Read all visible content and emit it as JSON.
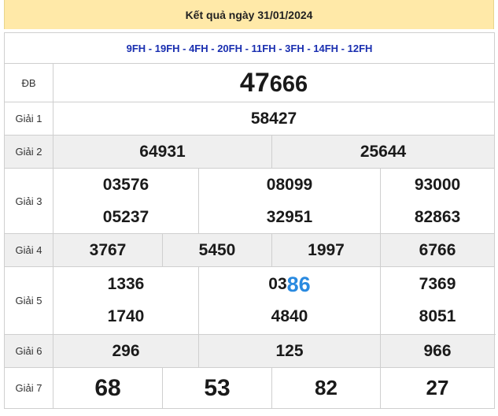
{
  "header": {
    "title": "Kết quả ngày 31/01/2024"
  },
  "codes": "9FH - 19FH - 4FH - 20FH - 11FH - 3FH - 14FH - 12FH",
  "labels": {
    "db": "ĐB",
    "g1": "Giải 1",
    "g2": "Giải 2",
    "g3": "Giải 3",
    "g4": "Giải 4",
    "g5": "Giải 5",
    "g6": "Giải 6",
    "g7": "Giải 7"
  },
  "db": {
    "prefix": "47",
    "suffix": "666"
  },
  "g1": [
    "58427"
  ],
  "g2": [
    "64931",
    "25644"
  ],
  "g3": [
    "03576",
    "08099",
    "93000",
    "05237",
    "32951",
    "82863"
  ],
  "g4": [
    "3767",
    "5450",
    "1997",
    "6766"
  ],
  "g5": {
    "r1c1": "1336",
    "r1c2_prefix": "03",
    "r1c2_suffix": "86",
    "r1c3": "7369",
    "r2c1": "1740",
    "r2c2": "4840",
    "r2c3": "8051"
  },
  "g6": [
    "296",
    "125",
    "966"
  ],
  "g7": [
    "68",
    "53",
    "82",
    "27"
  ],
  "colors": {
    "header_bg": "#ffe9a8",
    "codes": "#1a2fb0",
    "red": "#e31b1b",
    "blue": "#2a8ae0",
    "row_gray": "#efefef"
  }
}
